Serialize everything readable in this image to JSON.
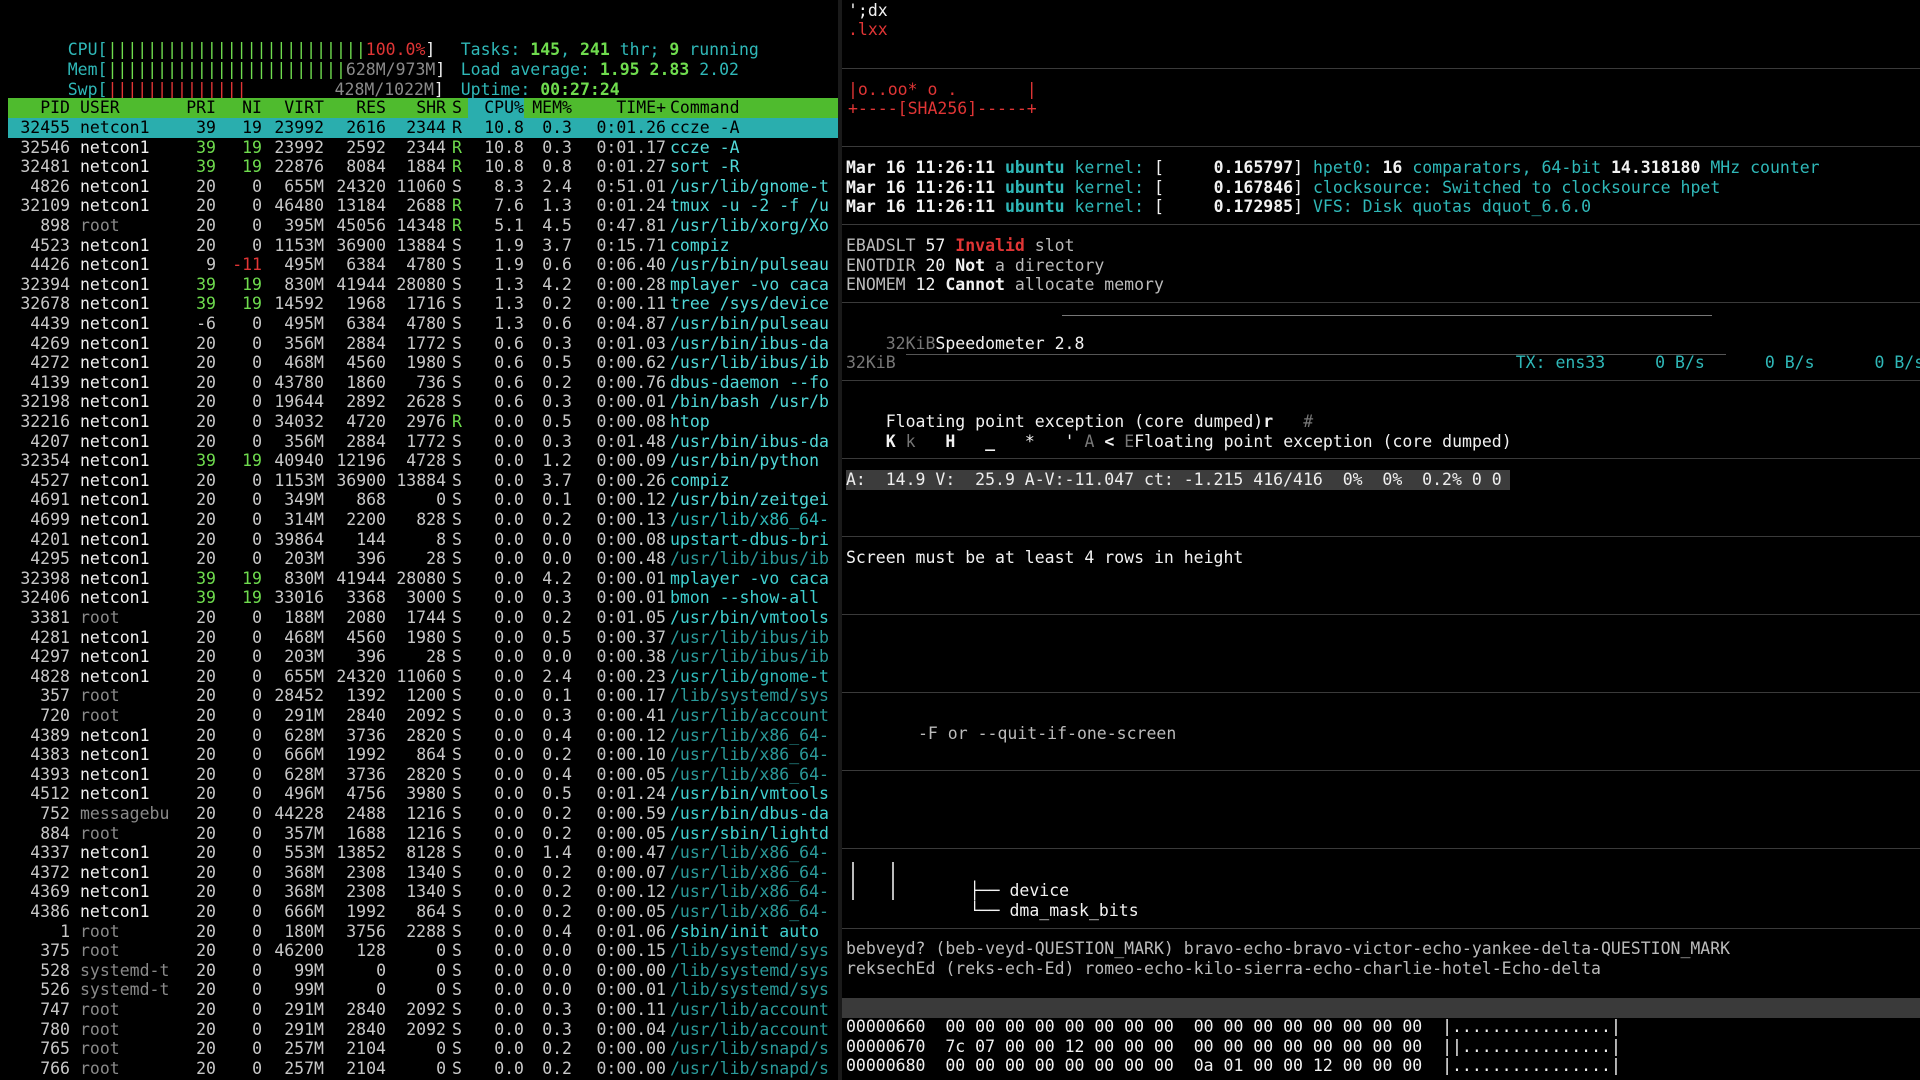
{
  "htop": {
    "meters": {
      "cpu_label": "CPU[",
      "cpu_bar": "||||||||||||||||||||||||||",
      "cpu_value": "100.0%",
      "mem_label": "Mem[",
      "mem_bar": "||||||||||||||||||||||||",
      "mem_value": "628M/973M",
      "swp_label": "Swp[",
      "swp_bar": "||||||||||||||",
      "swp_value": "428M/1022M",
      "close": "]"
    },
    "stats": {
      "tasks_label": "Tasks:",
      "tasks": "145",
      "thr": "241",
      "thr_label": "thr;",
      "running": "9",
      "running_label": "running",
      "load_label": "Load average:",
      "load1": "1.95",
      "load5": "2.83",
      "load15": "2.02",
      "uptime_label": "Uptime:",
      "uptime": "00:27:24"
    },
    "columns": {
      "pid": "PID",
      "user": "USER",
      "pri": "PRI",
      "ni": "NI",
      "virt": "VIRT",
      "res": "RES",
      "shr": "SHR",
      "s": "S",
      "cpu": "CPU%",
      "mem": "MEM%",
      "time": "TIME+",
      "cmd": "Command"
    },
    "processes": [
      {
        "pid": "32455",
        "user": "netcon1",
        "pri": "39",
        "ni": "19",
        "virt": "23992",
        "res": "2616",
        "shr": "2344",
        "s": "R",
        "cpu": "10.8",
        "mem": "0.3",
        "time": "0:01.26",
        "cmd": "ccze -A"
      },
      {
        "pid": "32546",
        "user": "netcon1",
        "pri": "39",
        "ni": "19",
        "virt": "23992",
        "res": "2592",
        "shr": "2344",
        "s": "R",
        "cpu": "10.8",
        "mem": "0.3",
        "time": "0:01.17",
        "cmd": "ccze -A"
      },
      {
        "pid": "32481",
        "user": "netcon1",
        "pri": "39",
        "ni": "19",
        "virt": "22876",
        "res": "8084",
        "shr": "1884",
        "s": "R",
        "cpu": "10.8",
        "mem": "0.8",
        "time": "0:01.27",
        "cmd": "sort -R"
      },
      {
        "pid": "4826",
        "user": "netcon1",
        "pri": "20",
        "ni": "0",
        "virt": "655M",
        "res": "24320",
        "shr": "11060",
        "s": "S",
        "cpu": "8.3",
        "mem": "2.4",
        "time": "0:51.01",
        "cmd": "/usr/lib/gnome-t"
      },
      {
        "pid": "32109",
        "user": "netcon1",
        "pri": "20",
        "ni": "0",
        "virt": "46480",
        "res": "13184",
        "shr": "2688",
        "s": "R",
        "cpu": "7.6",
        "mem": "1.3",
        "time": "0:01.24",
        "cmd": "tmux -u -2 -f /u"
      },
      {
        "pid": "898",
        "user": "root",
        "pri": "20",
        "ni": "0",
        "virt": "395M",
        "res": "45056",
        "shr": "14348",
        "s": "R",
        "cpu": "5.1",
        "mem": "4.5",
        "time": "0:47.81",
        "cmd": "/usr/lib/xorg/Xo"
      },
      {
        "pid": "4523",
        "user": "netcon1",
        "pri": "20",
        "ni": "0",
        "virt": "1153M",
        "res": "36900",
        "shr": "13884",
        "s": "S",
        "cpu": "1.9",
        "mem": "3.7",
        "time": "0:15.71",
        "cmd": "compiz"
      },
      {
        "pid": "4426",
        "user": "netcon1",
        "pri": "9",
        "ni": "-11",
        "virt": "495M",
        "res": "6384",
        "shr": "4780",
        "s": "S",
        "cpu": "1.9",
        "mem": "0.6",
        "time": "0:06.40",
        "cmd": "/usr/bin/pulseau"
      },
      {
        "pid": "32394",
        "user": "netcon1",
        "pri": "39",
        "ni": "19",
        "virt": "830M",
        "res": "41944",
        "shr": "28080",
        "s": "S",
        "cpu": "1.3",
        "mem": "4.2",
        "time": "0:00.28",
        "cmd": "mplayer -vo caca"
      },
      {
        "pid": "32678",
        "user": "netcon1",
        "pri": "39",
        "ni": "19",
        "virt": "14592",
        "res": "1968",
        "shr": "1716",
        "s": "S",
        "cpu": "1.3",
        "mem": "0.2",
        "time": "0:00.11",
        "cmd": "tree /sys/device"
      },
      {
        "pid": "4439",
        "user": "netcon1",
        "pri": "-6",
        "ni": "0",
        "virt": "495M",
        "res": "6384",
        "shr": "4780",
        "s": "S",
        "cpu": "1.3",
        "mem": "0.6",
        "time": "0:04.87",
        "cmd": "/usr/bin/pulseau"
      },
      {
        "pid": "4269",
        "user": "netcon1",
        "pri": "20",
        "ni": "0",
        "virt": "356M",
        "res": "2884",
        "shr": "1772",
        "s": "S",
        "cpu": "0.6",
        "mem": "0.3",
        "time": "0:01.03",
        "cmd": "/usr/bin/ibus-da"
      },
      {
        "pid": "4272",
        "user": "netcon1",
        "pri": "20",
        "ni": "0",
        "virt": "468M",
        "res": "4560",
        "shr": "1980",
        "s": "S",
        "cpu": "0.6",
        "mem": "0.5",
        "time": "0:00.62",
        "cmd": "/usr/lib/ibus/ib"
      },
      {
        "pid": "4139",
        "user": "netcon1",
        "pri": "20",
        "ni": "0",
        "virt": "43780",
        "res": "1860",
        "shr": "736",
        "s": "S",
        "cpu": "0.6",
        "mem": "0.2",
        "time": "0:00.76",
        "cmd": "dbus-daemon --fo"
      },
      {
        "pid": "32198",
        "user": "netcon1",
        "pri": "20",
        "ni": "0",
        "virt": "19644",
        "res": "2892",
        "shr": "2628",
        "s": "S",
        "cpu": "0.6",
        "mem": "0.3",
        "time": "0:00.01",
        "cmd": "/bin/bash /usr/b"
      },
      {
        "pid": "32216",
        "user": "netcon1",
        "pri": "20",
        "ni": "0",
        "virt": "34032",
        "res": "4720",
        "shr": "2976",
        "s": "R",
        "cpu": "0.0",
        "mem": "0.5",
        "time": "0:00.08",
        "cmd": "htop"
      },
      {
        "pid": "4207",
        "user": "netcon1",
        "pri": "20",
        "ni": "0",
        "virt": "356M",
        "res": "2884",
        "shr": "1772",
        "s": "S",
        "cpu": "0.0",
        "mem": "0.3",
        "time": "0:01.48",
        "cmd": "/usr/bin/ibus-da"
      },
      {
        "pid": "32354",
        "user": "netcon1",
        "pri": "39",
        "ni": "19",
        "virt": "40940",
        "res": "12196",
        "shr": "4728",
        "s": "S",
        "cpu": "0.0",
        "mem": "1.2",
        "time": "0:00.09",
        "cmd": "/usr/bin/python"
      },
      {
        "pid": "4527",
        "user": "netcon1",
        "pri": "20",
        "ni": "0",
        "virt": "1153M",
        "res": "36900",
        "shr": "13884",
        "s": "S",
        "cpu": "0.0",
        "mem": "3.7",
        "time": "0:00.26",
        "cmd": "compiz"
      },
      {
        "pid": "4691",
        "user": "netcon1",
        "pri": "20",
        "ni": "0",
        "virt": "349M",
        "res": "868",
        "shr": "0",
        "s": "S",
        "cpu": "0.0",
        "mem": "0.1",
        "time": "0:00.12",
        "cmd": "/usr/bin/zeitgei"
      },
      {
        "pid": "4699",
        "user": "netcon1",
        "pri": "20",
        "ni": "0",
        "virt": "314M",
        "res": "2200",
        "shr": "828",
        "s": "S",
        "cpu": "0.0",
        "mem": "0.2",
        "time": "0:00.13",
        "cmd": "/usr/lib/x86_64-"
      },
      {
        "pid": "4201",
        "user": "netcon1",
        "pri": "20",
        "ni": "0",
        "virt": "39864",
        "res": "144",
        "shr": "8",
        "s": "S",
        "cpu": "0.0",
        "mem": "0.0",
        "time": "0:00.08",
        "cmd": "upstart-dbus-bri"
      },
      {
        "pid": "4295",
        "user": "netcon1",
        "pri": "20",
        "ni": "0",
        "virt": "203M",
        "res": "396",
        "shr": "28",
        "s": "S",
        "cpu": "0.0",
        "mem": "0.0",
        "time": "0:00.48",
        "cmd": "/usr/lib/ibus/ib"
      },
      {
        "pid": "32398",
        "user": "netcon1",
        "pri": "39",
        "ni": "19",
        "virt": "830M",
        "res": "41944",
        "shr": "28080",
        "s": "S",
        "cpu": "0.0",
        "mem": "4.2",
        "time": "0:00.01",
        "cmd": "mplayer -vo caca"
      },
      {
        "pid": "32406",
        "user": "netcon1",
        "pri": "39",
        "ni": "19",
        "virt": "33016",
        "res": "3368",
        "shr": "3000",
        "s": "S",
        "cpu": "0.0",
        "mem": "0.3",
        "time": "0:00.01",
        "cmd": "bmon --show-all"
      },
      {
        "pid": "3381",
        "user": "root",
        "pri": "20",
        "ni": "0",
        "virt": "188M",
        "res": "2080",
        "shr": "1744",
        "s": "S",
        "cpu": "0.0",
        "mem": "0.2",
        "time": "0:01.05",
        "cmd": "/usr/bin/vmtools"
      },
      {
        "pid": "4281",
        "user": "netcon1",
        "pri": "20",
        "ni": "0",
        "virt": "468M",
        "res": "4560",
        "shr": "1980",
        "s": "S",
        "cpu": "0.0",
        "mem": "0.5",
        "time": "0:00.37",
        "cmd": "/usr/lib/ibus/ib"
      },
      {
        "pid": "4297",
        "user": "netcon1",
        "pri": "20",
        "ni": "0",
        "virt": "203M",
        "res": "396",
        "shr": "28",
        "s": "S",
        "cpu": "0.0",
        "mem": "0.0",
        "time": "0:00.38",
        "cmd": "/usr/lib/ibus/ib"
      },
      {
        "pid": "4828",
        "user": "netcon1",
        "pri": "20",
        "ni": "0",
        "virt": "655M",
        "res": "24320",
        "shr": "11060",
        "s": "S",
        "cpu": "0.0",
        "mem": "2.4",
        "time": "0:00.23",
        "cmd": "/usr/lib/gnome-t"
      },
      {
        "pid": "357",
        "user": "root",
        "pri": "20",
        "ni": "0",
        "virt": "28452",
        "res": "1392",
        "shr": "1200",
        "s": "S",
        "cpu": "0.0",
        "mem": "0.1",
        "time": "0:00.17",
        "cmd": "/lib/systemd/sys"
      },
      {
        "pid": "720",
        "user": "root",
        "pri": "20",
        "ni": "0",
        "virt": "291M",
        "res": "2840",
        "shr": "2092",
        "s": "S",
        "cpu": "0.0",
        "mem": "0.3",
        "time": "0:00.41",
        "cmd": "/usr/lib/account"
      },
      {
        "pid": "4389",
        "user": "netcon1",
        "pri": "20",
        "ni": "0",
        "virt": "628M",
        "res": "3736",
        "shr": "2820",
        "s": "S",
        "cpu": "0.0",
        "mem": "0.4",
        "time": "0:00.12",
        "cmd": "/usr/lib/x86_64-"
      },
      {
        "pid": "4383",
        "user": "netcon1",
        "pri": "20",
        "ni": "0",
        "virt": "666M",
        "res": "1992",
        "shr": "864",
        "s": "S",
        "cpu": "0.0",
        "mem": "0.2",
        "time": "0:00.10",
        "cmd": "/usr/lib/x86_64-"
      },
      {
        "pid": "4393",
        "user": "netcon1",
        "pri": "20",
        "ni": "0",
        "virt": "628M",
        "res": "3736",
        "shr": "2820",
        "s": "S",
        "cpu": "0.0",
        "mem": "0.4",
        "time": "0:00.05",
        "cmd": "/usr/lib/x86_64-"
      },
      {
        "pid": "4512",
        "user": "netcon1",
        "pri": "20",
        "ni": "0",
        "virt": "496M",
        "res": "4756",
        "shr": "3980",
        "s": "S",
        "cpu": "0.0",
        "mem": "0.5",
        "time": "0:01.24",
        "cmd": "/usr/bin/vmtools"
      },
      {
        "pid": "752",
        "user": "messagebu",
        "pri": "20",
        "ni": "0",
        "virt": "44228",
        "res": "2488",
        "shr": "1216",
        "s": "S",
        "cpu": "0.0",
        "mem": "0.2",
        "time": "0:00.59",
        "cmd": "/usr/bin/dbus-da"
      },
      {
        "pid": "884",
        "user": "root",
        "pri": "20",
        "ni": "0",
        "virt": "357M",
        "res": "1688",
        "shr": "1216",
        "s": "S",
        "cpu": "0.0",
        "mem": "0.2",
        "time": "0:00.05",
        "cmd": "/usr/sbin/lightd"
      },
      {
        "pid": "4337",
        "user": "netcon1",
        "pri": "20",
        "ni": "0",
        "virt": "553M",
        "res": "13852",
        "shr": "8128",
        "s": "S",
        "cpu": "0.0",
        "mem": "1.4",
        "time": "0:00.47",
        "cmd": "/usr/lib/x86_64-"
      },
      {
        "pid": "4372",
        "user": "netcon1",
        "pri": "20",
        "ni": "0",
        "virt": "368M",
        "res": "2308",
        "shr": "1340",
        "s": "S",
        "cpu": "0.0",
        "mem": "0.2",
        "time": "0:00.07",
        "cmd": "/usr/lib/x86_64-"
      },
      {
        "pid": "4369",
        "user": "netcon1",
        "pri": "20",
        "ni": "0",
        "virt": "368M",
        "res": "2308",
        "shr": "1340",
        "s": "S",
        "cpu": "0.0",
        "mem": "0.2",
        "time": "0:00.12",
        "cmd": "/usr/lib/x86_64-"
      },
      {
        "pid": "4386",
        "user": "netcon1",
        "pri": "20",
        "ni": "0",
        "virt": "666M",
        "res": "1992",
        "shr": "864",
        "s": "S",
        "cpu": "0.0",
        "mem": "0.2",
        "time": "0:00.05",
        "cmd": "/usr/lib/x86_64-"
      },
      {
        "pid": "1",
        "user": "root",
        "pri": "20",
        "ni": "0",
        "virt": "180M",
        "res": "3756",
        "shr": "2288",
        "s": "S",
        "cpu": "0.0",
        "mem": "0.4",
        "time": "0:01.06",
        "cmd": "/sbin/init auto"
      },
      {
        "pid": "375",
        "user": "root",
        "pri": "20",
        "ni": "0",
        "virt": "46200",
        "res": "128",
        "shr": "0",
        "s": "S",
        "cpu": "0.0",
        "mem": "0.0",
        "time": "0:00.15",
        "cmd": "/lib/systemd/sys"
      },
      {
        "pid": "528",
        "user": "systemd-t",
        "pri": "20",
        "ni": "0",
        "virt": "99M",
        "res": "0",
        "shr": "0",
        "s": "S",
        "cpu": "0.0",
        "mem": "0.0",
        "time": "0:00.00",
        "cmd": "/lib/systemd/sys"
      },
      {
        "pid": "526",
        "user": "systemd-t",
        "pri": "20",
        "ni": "0",
        "virt": "99M",
        "res": "0",
        "shr": "0",
        "s": "S",
        "cpu": "0.0",
        "mem": "0.0",
        "time": "0:00.01",
        "cmd": "/lib/systemd/sys"
      },
      {
        "pid": "747",
        "user": "root",
        "pri": "20",
        "ni": "0",
        "virt": "291M",
        "res": "2840",
        "shr": "2092",
        "s": "S",
        "cpu": "0.0",
        "mem": "0.3",
        "time": "0:00.11",
        "cmd": "/usr/lib/account"
      },
      {
        "pid": "780",
        "user": "root",
        "pri": "20",
        "ni": "0",
        "virt": "291M",
        "res": "2840",
        "shr": "2092",
        "s": "S",
        "cpu": "0.0",
        "mem": "0.3",
        "time": "0:00.04",
        "cmd": "/usr/lib/account"
      },
      {
        "pid": "765",
        "user": "root",
        "pri": "20",
        "ni": "0",
        "virt": "257M",
        "res": "2104",
        "shr": "0",
        "s": "S",
        "cpu": "0.0",
        "mem": "0.2",
        "time": "0:00.00",
        "cmd": "/usr/lib/snapd/s"
      },
      {
        "pid": "766",
        "user": "root",
        "pri": "20",
        "ni": "0",
        "virt": "257M",
        "res": "2104",
        "shr": "0",
        "s": "S",
        "cpu": "0.0",
        "mem": "0.2",
        "time": "0:00.00",
        "cmd": "/usr/lib/snapd/s"
      }
    ]
  },
  "right": {
    "top_a": "';dx",
    "top_b": ".lxx",
    "sha_a": "|o..oo* o .       |",
    "sha_b": "+----[SHA256]-----+",
    "kernel": [
      {
        "date": "Mar 16 11:26:11",
        "host": "ubuntu",
        "src": "kernel:",
        "open": "[",
        "ts": "0.165797",
        "close": "]",
        "msg_a": "hpet0:",
        "msg_b": "16",
        "msg_c": "comparators, 64-bit",
        "msg_d": "14.318180",
        "msg_e": "MHz counter"
      },
      {
        "date": "Mar 16 11:26:11",
        "host": "ubuntu",
        "src": "kernel:",
        "open": "[",
        "ts": "0.167846",
        "close": "]",
        "msg_a": "clocksource:",
        "msg_b": "",
        "msg_c": "Switched to clocksource hpet",
        "msg_d": "",
        "msg_e": ""
      },
      {
        "date": "Mar 16 11:26:11",
        "host": "ubuntu",
        "src": "kernel:",
        "open": "[",
        "ts": "0.172985",
        "close": "]",
        "msg_a": "VFS:",
        "msg_b": "",
        "msg_c": "Disk quotas dquot_6.6.0",
        "msg_d": "",
        "msg_e": ""
      }
    ],
    "errno": [
      {
        "name": "EBADSLT",
        "num": "57",
        "word": "Invalid",
        "rest": "slot",
        "color": "#e03535"
      },
      {
        "name": "ENOTDIR",
        "num": "20",
        "word": "Not",
        "rest": "a directory",
        "color": "#f2f2f2"
      },
      {
        "name": "ENOMEM",
        "num": "12",
        "word": "Cannot",
        "rest": "allocate memory",
        "color": "#f2f2f2"
      }
    ],
    "speed_a": "32KiB",
    "speed_title": "Speedometer 2.8",
    "tx_label": "TX: ens33",
    "tx_v1": "0 B/s",
    "tx_v2": "0 B/s",
    "tx_v3": "0 B/s",
    "speed_b": "32KiB",
    "fpe_line1_a": "Floating point exception (core dumped)",
    "fpe_line1_b": "r",
    "fpe_line1_c": "#",
    "fpe_line2_a": "K",
    "fpe_line2_b": "k",
    "fpe_line2_c": "H",
    "fpe_line2_d": "_",
    "fpe_line2_e": "*",
    "fpe_line2_f": "'",
    "fpe_line2_g": "A",
    "fpe_line2_h": "<",
    "fpe_line2_i": "E",
    "fpe_line2_j": "Floating point exception (core dumped)",
    "mplayer_status": "A:  14.9 V:  25.9 A-V:-11.047 ct: -1.215 416/416  0%  0%  0.2% 0 0",
    "screen_msg": "Screen must be at least 4 rows in height",
    "less_opt": "-F or --quit-if-one-screen",
    "tree_a": "device",
    "tree_b": "dma_mask_bits",
    "tree_branch_a": "├── ",
    "tree_branch_b": "└── ",
    "nato_a": "bebveyd? (beb-veyd-QUESTION_MARK) bravo-echo-bravo-victor-echo-yankee-delta-QUESTION_MARK",
    "nato_b": "reksechEd (reks-ech-Ed) romeo-echo-kilo-sierra-echo-charlie-hotel-Echo-delta",
    "hex": [
      {
        "addr": "00000660",
        "bytes": "00 00 00 00 00 00 00 00  00 00 00 00 00 00 00 00",
        "ascii": "|................|"
      },
      {
        "addr": "00000670",
        "bytes": "7c 07 00 00 12 00 00 00  00 00 00 00 00 00 00 00",
        "ascii": "||...............|"
      },
      {
        "addr": "00000680",
        "bytes": "00 00 00 00 00 00 00 00  0a 01 00 00 12 00 00 00",
        "ascii": "|................|"
      }
    ]
  },
  "colors": {
    "cyan": "#2fb8b8",
    "green": "#6fdc4e",
    "red": "#e03535",
    "header_bg": "#4fbb2e",
    "selected_bg": "#2aaeae"
  }
}
